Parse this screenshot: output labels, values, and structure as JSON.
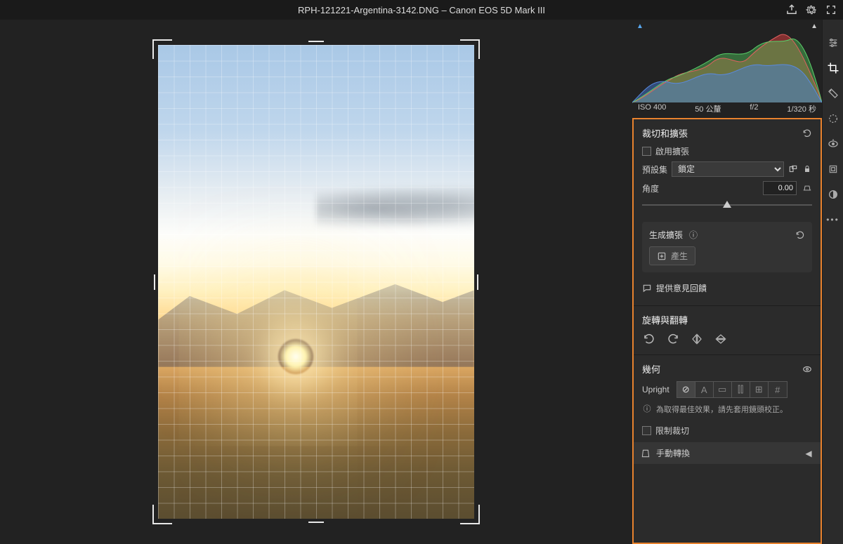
{
  "header": {
    "title": "RPH-121221-Argentina-3142.DNG  –  Canon EOS 5D Mark III"
  },
  "histogram": {
    "iso": "ISO 400",
    "focal": "50 公釐",
    "aperture": "f/2",
    "shutter": "1/320 秒"
  },
  "crop": {
    "title": "裁切和擴張",
    "enable_expand": "啟用擴張",
    "preset_label": "預設集",
    "preset_value": "鎖定",
    "angle_label": "角度",
    "angle_value": "0.00"
  },
  "gen": {
    "title": "生成擴張",
    "generate": "產生",
    "feedback": "提供意見回饋"
  },
  "rotate": {
    "title": "旋轉與翻轉"
  },
  "geometry": {
    "title": "幾何",
    "upright_label": "Upright",
    "hint": "為取得最佳效果，請先套用鏡頭校正。",
    "constrain": "限制裁切",
    "manual": "手動轉換"
  }
}
